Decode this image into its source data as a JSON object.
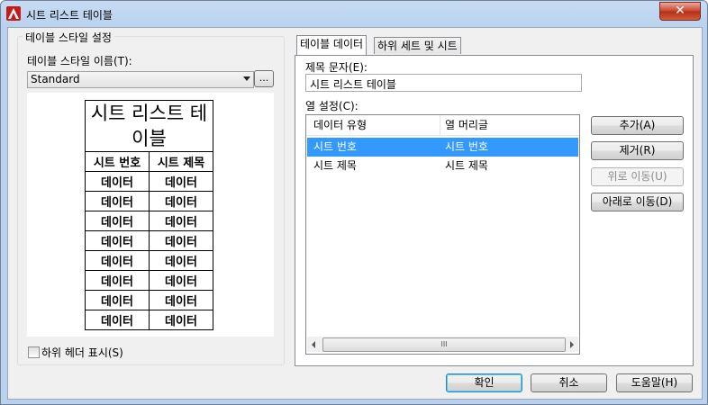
{
  "window": {
    "title": "시트 리스트 테이블",
    "close_symbol": "✕"
  },
  "left_panel": {
    "group_title": "테이블 스타일 설정",
    "style_name_label": "테이블 스타일 이름(T):",
    "style_name_value": "Standard",
    "browse_label": "...",
    "preview": {
      "title": "시트 리스트 테이블",
      "headers": [
        "시트 번호",
        "시트 제목"
      ],
      "rows": [
        [
          "데이터",
          "데이터"
        ],
        [
          "데이터",
          "데이터"
        ],
        [
          "데이터",
          "데이터"
        ],
        [
          "데이터",
          "데이터"
        ],
        [
          "데이터",
          "데이터"
        ],
        [
          "데이터",
          "데이터"
        ],
        [
          "데이터",
          "데이터"
        ],
        [
          "데이터",
          "데이터"
        ]
      ]
    },
    "show_subheader_label": "하위 헤더 표시(S)",
    "show_subheader_checked": false
  },
  "tabs": [
    "테이블 데이터",
    "하위 세트 및 시트"
  ],
  "active_tab": 0,
  "table_data": {
    "title_text_label": "제목 문자(E):",
    "title_text_value": "시트 리스트 테이블",
    "column_settings_label": "열 설정(C):",
    "columns": [
      "데이터 유형",
      "열 머리글"
    ],
    "rows": [
      {
        "type": "시트 번호",
        "heading": "시트 번호",
        "selected": true
      },
      {
        "type": "시트 제목",
        "heading": "시트 제목",
        "selected": false
      }
    ],
    "scroll_grip": "III"
  },
  "side_buttons": {
    "add": "추가(A)",
    "remove": "제거(R)",
    "move_up": "위로 이동(U)",
    "move_down": "아래로 이동(D)"
  },
  "footer_buttons": {
    "ok": "확인",
    "cancel": "취소",
    "help": "도움말(H)"
  },
  "colors": {
    "selection": "#3399ff",
    "title_gradient": "#b9d1ee",
    "app_icon": "#c81a1a"
  }
}
